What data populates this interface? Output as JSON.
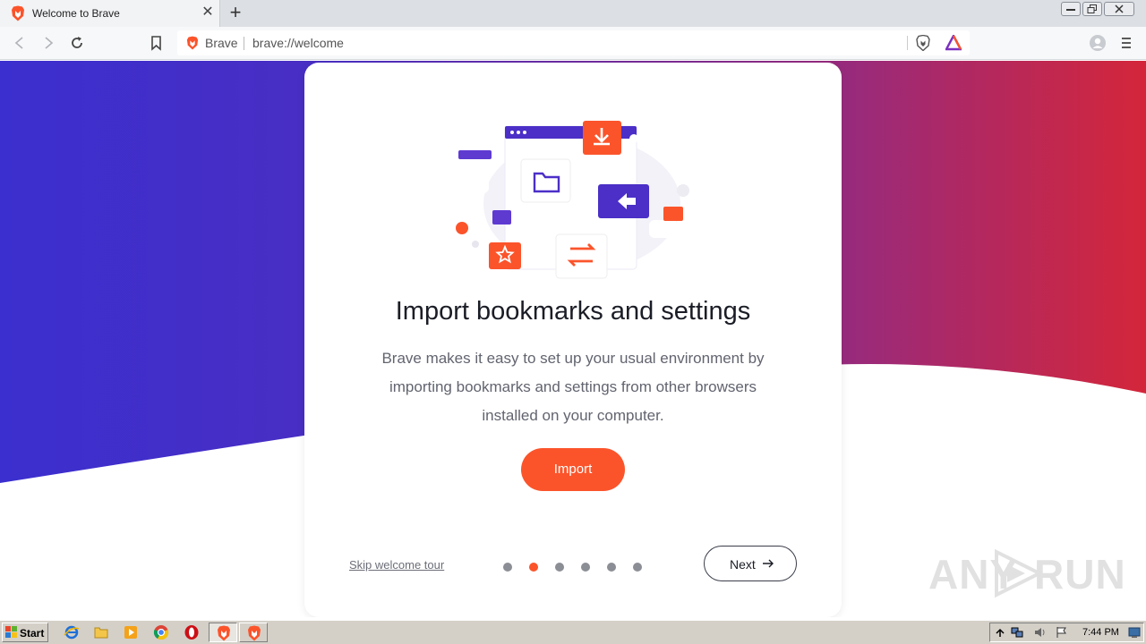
{
  "browser": {
    "tab": {
      "title": "Welcome to Brave",
      "close_label": "✕"
    },
    "new_tab_label": "+",
    "omnibox": {
      "brand": "Brave",
      "url": "brave://welcome"
    }
  },
  "welcome_card": {
    "title": "Import bookmarks and settings",
    "description_lines": [
      "Brave makes it easy to set up your usual environment by",
      "importing bookmarks and settings from other browsers",
      "installed on your computer."
    ],
    "import_label": "Import",
    "skip_label": "Skip welcome tour",
    "next_label": "Next",
    "steps_total": 6,
    "active_step": 2
  },
  "watermark": {
    "left": "ANY",
    "right": "RUN"
  },
  "taskbar": {
    "start_label": "Start",
    "clock": "7:44 PM"
  },
  "colors": {
    "brave_orange": "#fb542b",
    "gradient_left": "#3b2fcf",
    "gradient_right": "#d4263a"
  }
}
